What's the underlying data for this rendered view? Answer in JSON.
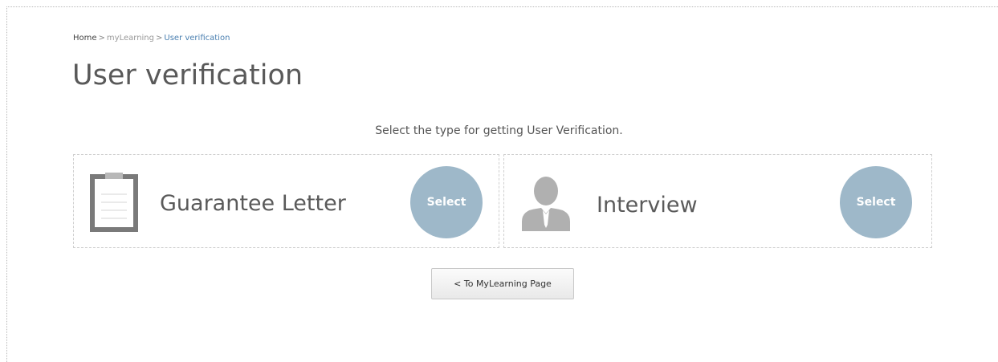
{
  "breadcrumb": {
    "home": "Home",
    "separator": ">",
    "section": "myLearning",
    "current": "User verification"
  },
  "page": {
    "title": "User verification",
    "instruction": "Select the type for getting User Verification."
  },
  "options": [
    {
      "label": "Guarantee Letter",
      "icon": "clipboard-icon",
      "button_label": "Select"
    },
    {
      "label": "Interview",
      "icon": "person-icon",
      "button_label": "Select"
    }
  ],
  "actions": {
    "back_label": "< To MyLearning Page"
  },
  "colors": {
    "select_button": "#9eb8c9",
    "icon_gray": "#7a7a7a",
    "person_gray": "#b0b0b0",
    "breadcrumb_current": "#4a7fb0"
  }
}
